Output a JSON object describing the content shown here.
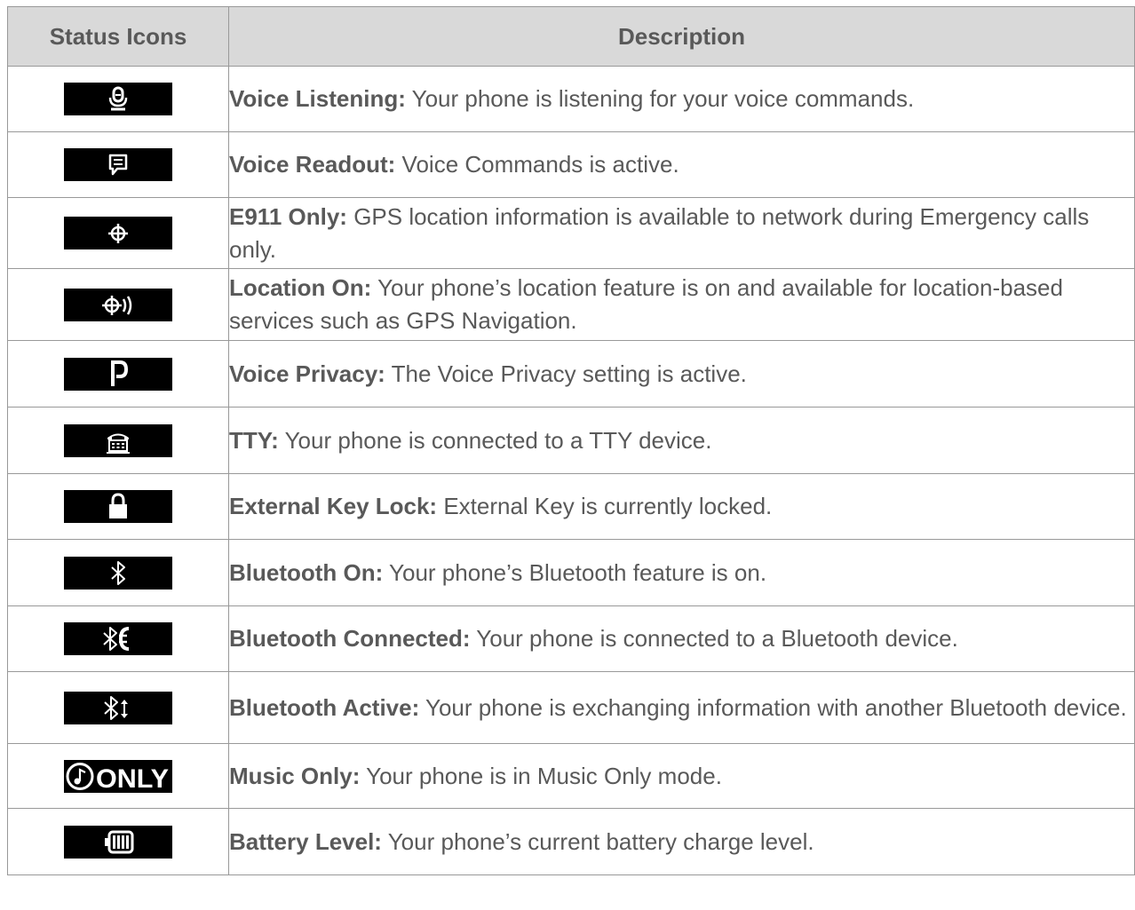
{
  "table": {
    "headers": {
      "icons": "Status Icons",
      "description": "Description"
    },
    "rows": [
      {
        "icon": "voice-listening-icon",
        "term": "Voice Listening:",
        "text": " Your phone is listening for your voice commands."
      },
      {
        "icon": "voice-readout-icon",
        "term": "Voice Readout:",
        "text": " Voice Commands is active."
      },
      {
        "icon": "e911-only-icon",
        "term": "E911 Only:",
        "text": " GPS location information is available to network during Emergency calls only."
      },
      {
        "icon": "location-on-icon",
        "term": "Location On:",
        "text": " Your phone’s location feature is on and available for location-based services such as GPS Navigation."
      },
      {
        "icon": "voice-privacy-icon",
        "term": "Voice Privacy:",
        "text": " The Voice Privacy setting is active."
      },
      {
        "icon": "tty-icon",
        "term": "TTY:",
        "text": " Your phone is connected to a TTY device."
      },
      {
        "icon": "external-key-lock-icon",
        "term": "External Key Lock:",
        "text": " External Key is currently locked."
      },
      {
        "icon": "bluetooth-on-icon",
        "term": "Bluetooth On:",
        "text": " Your phone’s Bluetooth feature is on."
      },
      {
        "icon": "bluetooth-connected-icon",
        "term": "Bluetooth Connected:",
        "text": " Your phone is connected to a Bluetooth device."
      },
      {
        "icon": "bluetooth-active-icon",
        "term": "Bluetooth Active:",
        "text": " Your phone is exchanging information with another Bluetooth device."
      },
      {
        "icon": "music-only-icon",
        "icon_text": "ONLY",
        "term": "Music Only:",
        "text": " Your phone is in Music Only mode."
      },
      {
        "icon": "battery-level-icon",
        "term": "Battery Level:",
        "text": " Your phone’s current battery charge level."
      }
    ]
  },
  "colors": {
    "text": "#595959",
    "header_bg": "#d9d9d9",
    "border": "#999999",
    "icon_bg": "#000000",
    "icon_fg": "#ffffff"
  }
}
